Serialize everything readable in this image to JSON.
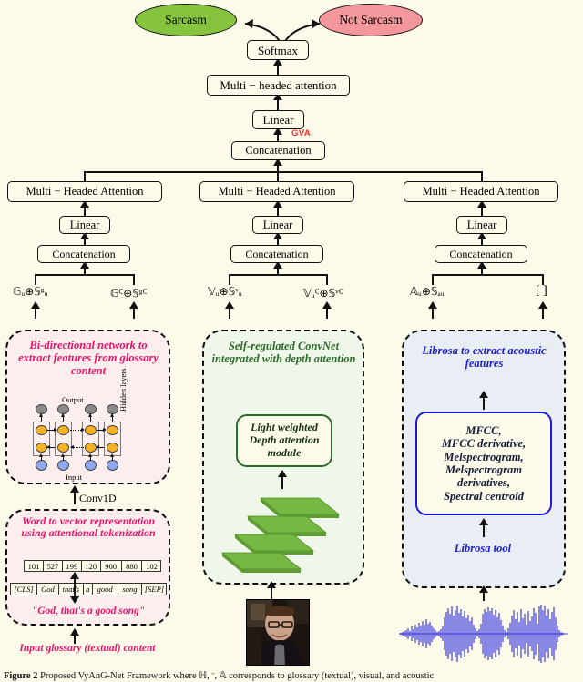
{
  "figure": {
    "caption_prefix": "Figure 2",
    "caption_text": " Proposed VyAnG-Net Framework where ℍ, ᵔ, 𝔸 corresponds to glossary (textual), visual, and acoustic"
  },
  "outputs": {
    "positive_label": "Sarcasm",
    "negative_label": "Not Sarcasm",
    "positive_color": "#86c440",
    "negative_color": "#f4979c"
  },
  "fusion": {
    "softmax_label": "Softmax",
    "multiheaded_attention_label": "Multi − headed attention",
    "linear_label": "Linear",
    "concatenation_label": "Concatenation",
    "gva_label": "GVA",
    "gva_color": "#ff2a2a"
  },
  "branches": [
    {
      "id": "glossary",
      "attention_label": "Multi − Headed Attention",
      "linear_label": "Linear",
      "concatenation_label": "Concatenation",
      "feature_left": "𝔾ᵤ⊕𝕊ᵍᵤ",
      "feature_right": "𝔾ꟲ⊕𝕊ᵍꟲ"
    },
    {
      "id": "visual",
      "attention_label": "Multi − Headed Attention",
      "linear_label": "Linear",
      "concatenation_label": "Concatenation",
      "feature_left": "𝕍ᵤ⊕𝕊ᵛᵤ",
      "feature_right": "𝕍ᵤꟲ⊕𝕊ᵛꟲ"
    },
    {
      "id": "acoustic",
      "attention_label": "Multi − Headed Attention",
      "linear_label": "Linear",
      "concatenation_label": "Concatenation",
      "feature_left": "𝔸ᵤ⊕𝕊ₐᵤ",
      "feature_right": "[ ]"
    }
  ],
  "glossary_panel": {
    "title": "Bi-directional network to extract features from glossary content",
    "output_label": "Output",
    "input_label": "Input",
    "hidden_label": "Hidden layers",
    "conv_label": "Conv1D",
    "color": "#ec1368"
  },
  "tokenization_panel": {
    "title": "Word to vector representation using attentional tokenization",
    "token_ids": [
      "101",
      "527",
      "199",
      "120",
      "900",
      "880",
      "102"
    ],
    "tokens": [
      "[CLS]",
      "God",
      "that's",
      "a",
      "good",
      "song",
      "[SEP]"
    ],
    "sentence": "\"God, that's a good song\"",
    "color": "#ec1368"
  },
  "input_glossary": {
    "label": "Input glossary (textual) content",
    "color": "#ec1368"
  },
  "visual_panel": {
    "title": "Self-regulated ConvNet integrated with depth attention",
    "module_label": "Light weighted Depth attention module",
    "layer_count": 4,
    "layer_color": "#76b843",
    "color": "#2f6b2a"
  },
  "acoustic_panel": {
    "title": "Librosa to extract acoustic features",
    "features": [
      "MFCC,",
      "MFCC derivative,",
      "Melspectrogram,",
      "Melspectrogram",
      "derivatives,",
      "Spectral centroid"
    ],
    "tool_label": "Librosa tool",
    "waveform_color": "#1515e0",
    "color": "#1b1bdd"
  }
}
